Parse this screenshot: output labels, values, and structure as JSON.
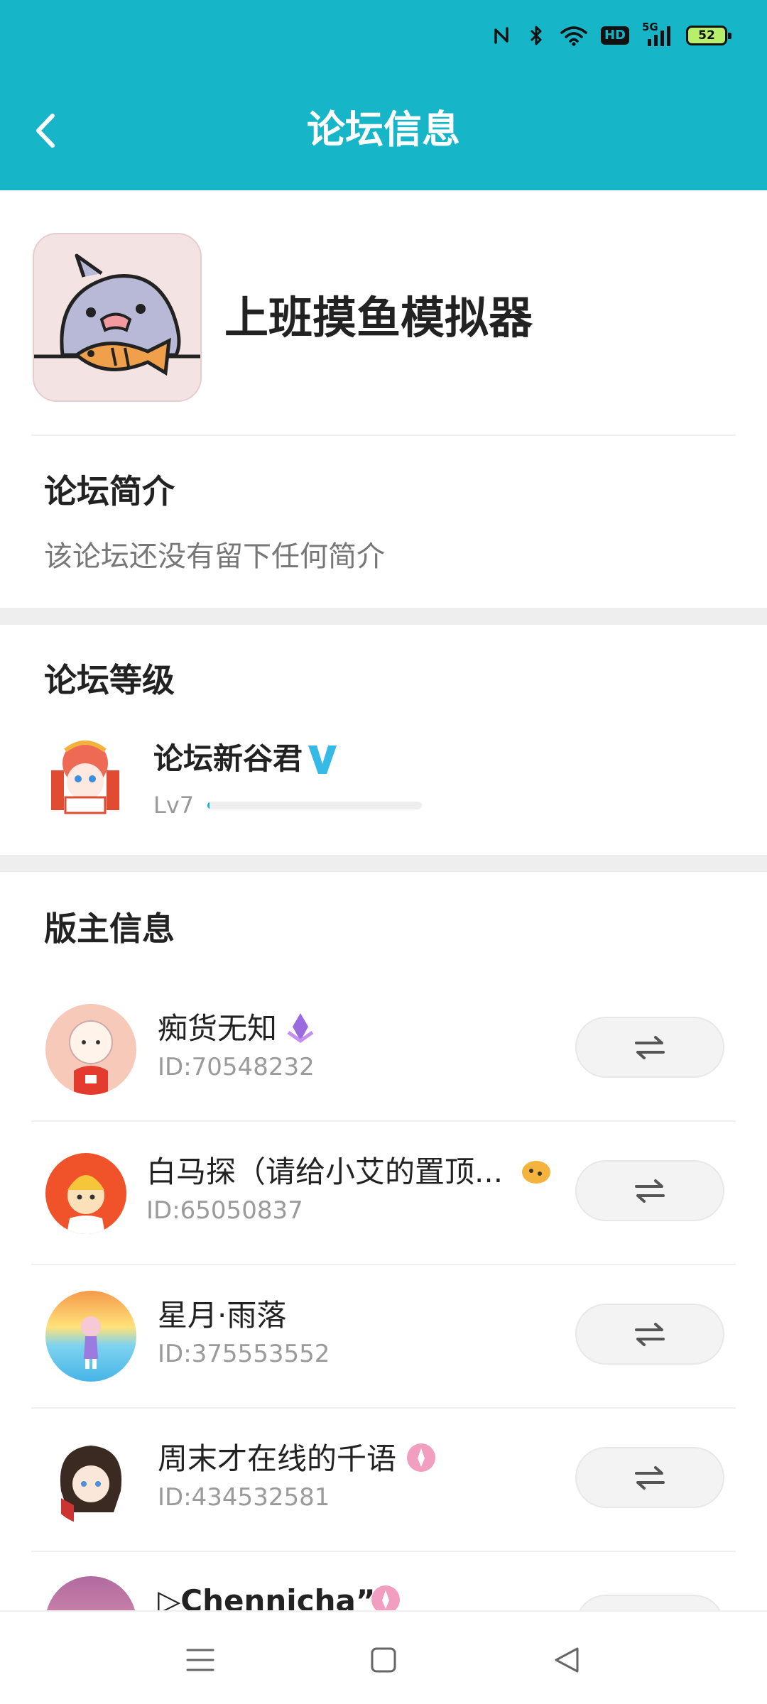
{
  "status_bar": {
    "battery_level": "52",
    "hd_label": "HD",
    "network_label": "5G",
    "icons": [
      "nfc-icon",
      "bluetooth-icon",
      "wifi-icon",
      "hd-icon",
      "signal-5g-icon",
      "battery-icon"
    ]
  },
  "header": {
    "title": "论坛信息",
    "back_icon": "chevron-left-icon"
  },
  "forum": {
    "name": "上班摸鱼模拟器",
    "icon": "shark-with-fish-icon"
  },
  "intro": {
    "title": "论坛简介",
    "text": "该论坛还没有留下任何简介"
  },
  "level": {
    "title": "论坛等级",
    "name": "论坛新谷君",
    "verified_icon": "v-verified-icon",
    "level_text": "Lv7",
    "progress_fraction": 0.01
  },
  "moderators": {
    "title": "版主信息",
    "items": [
      {
        "name": "痴货无知",
        "id": "ID:70548232",
        "badge_icon": "purple-crystal-badge-icon",
        "avatar_color": "#f7c9b9"
      },
      {
        "name": "白马探（请给小艾的置顶...",
        "id": "ID:65050837",
        "badge_icon": "orange-cookie-badge-icon",
        "avatar_color": "#f0522a"
      },
      {
        "name": "星月·雨落",
        "id": "ID:375553552",
        "badge_icon": "",
        "avatar_color": "#7fd3ef"
      },
      {
        "name": "周末才在线的千语",
        "id": "ID:434532581",
        "badge_icon": "pink-round-badge-icon",
        "avatar_color": "#ffffff"
      },
      {
        "name": "▷Chennicha”ღ",
        "id": "",
        "badge_icon": "pink-round-badge-icon",
        "avatar_color": "#e8a0b4"
      }
    ],
    "switch_icon": "swap-arrows-icon"
  },
  "navbar": {
    "icons": [
      "menu-icon",
      "home-square-icon",
      "back-triangle-icon"
    ]
  },
  "colors": {
    "accent": "#16b6c8",
    "band": "#eeeeee"
  }
}
